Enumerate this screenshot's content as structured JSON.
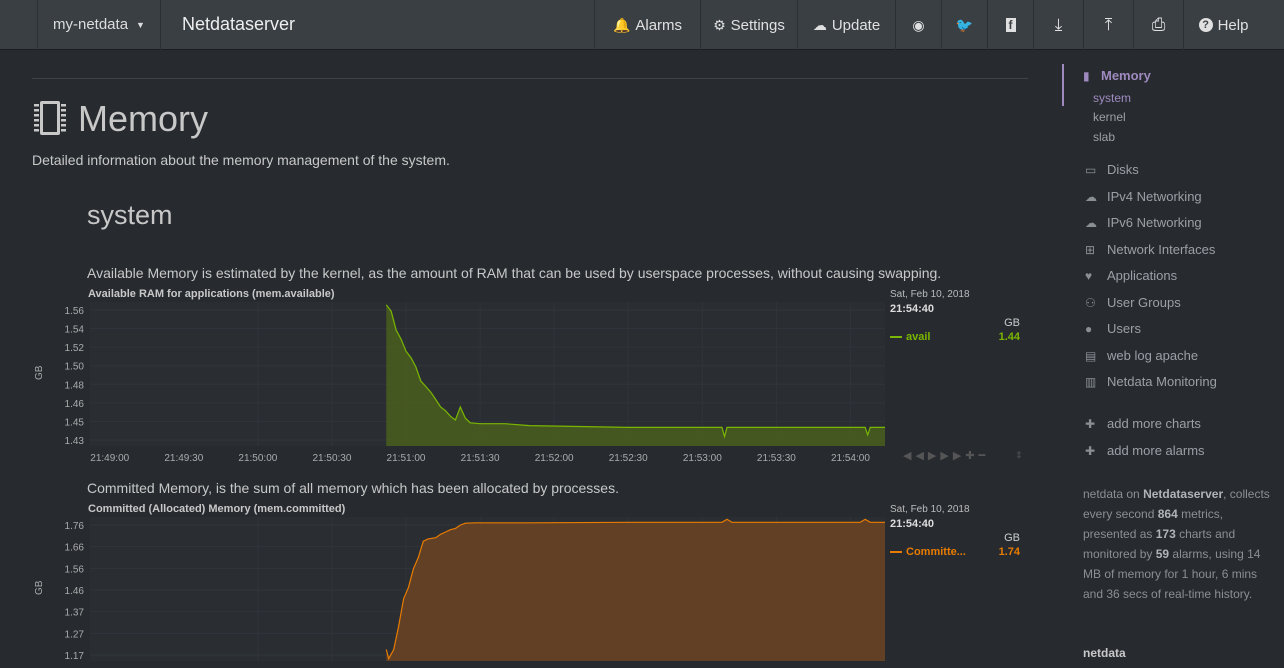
{
  "navbar": {
    "dropdown_label": "my-netdata",
    "server_name": "Netdataserver",
    "items": [
      {
        "label": "Alarms",
        "icon": "bell-icon",
        "glyph": "🔔"
      },
      {
        "label": "Settings",
        "icon": "gear-icon",
        "glyph": "⚙"
      },
      {
        "label": "Update",
        "icon": "cloud-download-icon",
        "glyph": "☁"
      },
      {
        "label": "",
        "icon": "github-icon",
        "glyph": "◉"
      },
      {
        "label": "",
        "icon": "twitter-icon",
        "glyph": "🐦"
      },
      {
        "label": "",
        "icon": "facebook-icon",
        "glyph": "f"
      },
      {
        "label": "",
        "icon": "download-icon",
        "glyph": "⤓"
      },
      {
        "label": "",
        "icon": "upload-icon",
        "glyph": "⤒"
      },
      {
        "label": "",
        "icon": "print-icon",
        "glyph": "⎙"
      },
      {
        "label": "Help",
        "icon": "question-circle-icon",
        "glyph": "?"
      }
    ]
  },
  "section": {
    "title": "Memory",
    "description": "Detailed information about the memory management of the system.",
    "subsection_title": "system"
  },
  "charts": [
    {
      "description": "Available Memory is estimated by the kernel, as the amount of RAM that can be used by userspace processes, without causing swapping.",
      "title": "Available RAM for applications (mem.available)",
      "legend_date": "Sat, Feb 10, 2018",
      "legend_time": "21:54:40",
      "unit": "GB",
      "series_name": "avail",
      "series_value": "1.44",
      "color": "#7ab700",
      "fill": "#4a5e1d"
    },
    {
      "description": "Committed Memory, is the sum of all memory which has been allocated by processes.",
      "title": "Committed (Allocated) Memory (mem.committed)",
      "legend_date": "Sat, Feb 10, 2018",
      "legend_time": "21:54:40",
      "unit": "GB",
      "series_name": "Committe...",
      "series_value": "1.74",
      "color": "#e87b00",
      "fill": "#6b4325"
    }
  ],
  "chart_data": [
    {
      "type": "area",
      "title": "Available RAM for applications (mem.available)",
      "ylabel": "GB",
      "y_ticks": [
        "1.56",
        "1.54",
        "1.52",
        "1.50",
        "1.48",
        "1.46",
        "1.45",
        "1.43"
      ],
      "x_ticks": [
        "21:49:00",
        "21:49:30",
        "21:50:00",
        "21:50:30",
        "21:51:00",
        "21:51:30",
        "21:52:00",
        "21:52:30",
        "21:53:00",
        "21:53:30",
        "21:54:00",
        "21:54:30"
      ],
      "ylim": [
        1.42,
        1.575
      ],
      "xlim_seconds": [
        -68,
        254
      ],
      "series": [
        {
          "name": "avail",
          "points": [
            [
              52,
              1.572
            ],
            [
              54,
              1.565
            ],
            [
              56,
              1.545
            ],
            [
              58,
              1.535
            ],
            [
              60,
              1.522
            ],
            [
              62,
              1.515
            ],
            [
              64,
              1.505
            ],
            [
              66,
              1.49
            ],
            [
              68,
              1.484
            ],
            [
              70,
              1.478
            ],
            [
              72,
              1.47
            ],
            [
              74,
              1.462
            ],
            [
              76,
              1.458
            ],
            [
              78,
              1.452
            ],
            [
              80,
              1.448
            ],
            [
              82,
              1.462
            ],
            [
              84,
              1.45
            ],
            [
              86,
              1.445
            ],
            [
              90,
              1.444
            ],
            [
              100,
              1.444
            ],
            [
              110,
              1.442
            ],
            [
              150,
              1.44
            ],
            [
              180,
              1.44
            ],
            [
              188,
              1.44
            ],
            [
              189,
              1.43
            ],
            [
              190,
              1.44
            ],
            [
              240,
              1.44
            ],
            [
              246,
              1.44
            ],
            [
              247,
              1.432
            ],
            [
              248,
              1.44
            ],
            [
              254,
              1.44
            ]
          ]
        }
      ]
    },
    {
      "type": "area",
      "title": "Committed (Allocated) Memory (mem.committed)",
      "ylabel": "GB",
      "y_ticks": [
        "1.76",
        "1.66",
        "1.56",
        "1.46",
        "1.37",
        "1.27",
        "1.17"
      ],
      "x_ticks": [],
      "ylim": [
        1.15,
        1.775
      ],
      "xlim_seconds": [
        -68,
        254
      ],
      "series": [
        {
          "name": "Committe...",
          "points": [
            [
              52,
              1.2
            ],
            [
              53,
              1.16
            ],
            [
              55,
              1.2
            ],
            [
              57,
              1.3
            ],
            [
              59,
              1.42
            ],
            [
              61,
              1.47
            ],
            [
              63,
              1.55
            ],
            [
              65,
              1.6
            ],
            [
              67,
              1.67
            ],
            [
              69,
              1.68
            ],
            [
              72,
              1.685
            ],
            [
              74,
              1.7
            ],
            [
              76,
              1.71
            ],
            [
              78,
              1.72
            ],
            [
              80,
              1.725
            ],
            [
              82,
              1.74
            ],
            [
              84,
              1.748
            ],
            [
              88,
              1.75
            ],
            [
              110,
              1.75
            ],
            [
              150,
              1.752
            ],
            [
              188,
              1.752
            ],
            [
              190,
              1.765
            ],
            [
              192,
              1.752
            ],
            [
              244,
              1.752
            ],
            [
              246,
              1.765
            ],
            [
              248,
              1.752
            ],
            [
              254,
              1.752
            ]
          ]
        }
      ]
    }
  ],
  "sidebar": {
    "active_section": "Memory",
    "memory_subitems": [
      "system",
      "kernel",
      "slab"
    ],
    "items": [
      {
        "label": "Disks",
        "icon": "hdd-icon",
        "glyph": "▭"
      },
      {
        "label": "IPv4 Networking",
        "icon": "cloud-icon",
        "glyph": "☁"
      },
      {
        "label": "IPv6 Networking",
        "icon": "cloud-icon",
        "glyph": "☁"
      },
      {
        "label": "Network Interfaces",
        "icon": "sitemap-icon",
        "glyph": "⊞"
      },
      {
        "label": "Applications",
        "icon": "heartbeat-icon",
        "glyph": "♥"
      },
      {
        "label": "User Groups",
        "icon": "users-icon",
        "glyph": "⚇"
      },
      {
        "label": "Users",
        "icon": "user-icon",
        "glyph": "●"
      },
      {
        "label": "web log apache",
        "icon": "file-icon",
        "glyph": "▤"
      },
      {
        "label": "Netdata Monitoring",
        "icon": "bar-chart-icon",
        "glyph": "▥"
      },
      {
        "label": "add more charts",
        "icon": "plus-icon",
        "glyph": "✚"
      },
      {
        "label": "add more alarms",
        "icon": "plus-icon",
        "glyph": "✚"
      }
    ],
    "info": {
      "t1": "netdata on ",
      "server": "Netdataserver",
      "t2": ", collects every second ",
      "metrics": "864",
      "t3": " metrics, presented as ",
      "charts": "173",
      "t4": " charts and monitored by ",
      "alarms": "59",
      "t5": " alarms, using 14 MB of memory for 1 hour, 6 mins and 36 secs of real-time history."
    },
    "footer_title": "netdata"
  }
}
